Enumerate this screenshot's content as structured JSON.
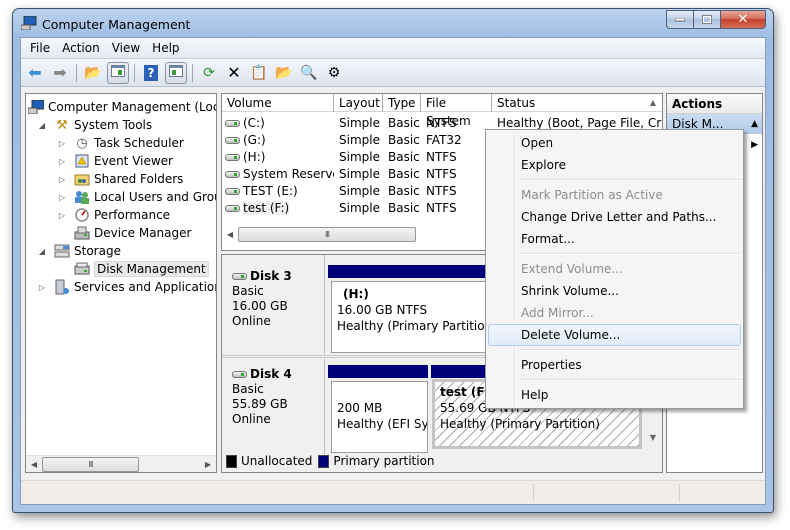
{
  "window": {
    "title": "Computer Management",
    "controls": {
      "minimize": "minimize",
      "maximize": "maximize",
      "close": "close"
    }
  },
  "menubar": [
    "File",
    "Action",
    "View",
    "Help"
  ],
  "toolbar": [
    {
      "name": "back-icon"
    },
    {
      "name": "forward-icon"
    },
    {
      "name": "up-folder-icon"
    },
    {
      "name": "show-hide-tree-icon"
    },
    {
      "name": "help-icon"
    },
    {
      "name": "show-hide-action-pane-icon"
    },
    {
      "name": "refresh-icon"
    },
    {
      "name": "delete-icon"
    },
    {
      "name": "properties-icon"
    },
    {
      "name": "open-folder-icon"
    },
    {
      "name": "search-icon"
    },
    {
      "name": "settings-icon"
    }
  ],
  "tree": {
    "items": [
      {
        "label": "Computer Management (Local",
        "level": 0,
        "expander": "",
        "icon": "computer-icon"
      },
      {
        "label": "System Tools",
        "level": 1,
        "expander": "◢",
        "icon": "tools-icon"
      },
      {
        "label": "Task Scheduler",
        "level": 2,
        "expander": "▷",
        "icon": "clock-icon"
      },
      {
        "label": "Event Viewer",
        "level": 2,
        "expander": "▷",
        "icon": "event-viewer-icon"
      },
      {
        "label": "Shared Folders",
        "level": 2,
        "expander": "▷",
        "icon": "shared-folder-icon"
      },
      {
        "label": "Local Users and Groups",
        "level": 2,
        "expander": "▷",
        "icon": "users-icon"
      },
      {
        "label": "Performance",
        "level": 2,
        "expander": "▷",
        "icon": "performance-icon"
      },
      {
        "label": "Device Manager",
        "level": 2,
        "expander": "",
        "icon": "device-manager-icon"
      },
      {
        "label": "Storage",
        "level": 1,
        "expander": "◢",
        "icon": "storage-icon"
      },
      {
        "label": "Disk Management",
        "level": 2,
        "expander": "",
        "icon": "disk-management-icon",
        "selected": true
      },
      {
        "label": "Services and Applications",
        "level": 1,
        "expander": "▷",
        "icon": "services-icon"
      }
    ],
    "scroll_thumb": "III"
  },
  "volumes": {
    "columns": [
      "Volume",
      "Layout",
      "Type",
      "File System",
      "Status"
    ],
    "rows": [
      {
        "volume": "(C:)",
        "layout": "Simple",
        "type": "Basic",
        "fs": "NTFS",
        "status": "Healthy (Boot, Page File, Cr"
      },
      {
        "volume": "(G:)",
        "layout": "Simple",
        "type": "Basic",
        "fs": "FAT32",
        "status": ""
      },
      {
        "volume": "(H:)",
        "layout": "Simple",
        "type": "Basic",
        "fs": "NTFS",
        "status": ""
      },
      {
        "volume": "System Reserved",
        "layout": "Simple",
        "type": "Basic",
        "fs": "NTFS",
        "status": ""
      },
      {
        "volume": "TEST (E:)",
        "layout": "Simple",
        "type": "Basic",
        "fs": "NTFS",
        "status": ""
      },
      {
        "volume": "test (F:)",
        "layout": "Simple",
        "type": "Basic",
        "fs": "NTFS",
        "status": ""
      }
    ],
    "scroll_thumb": "III"
  },
  "disks": [
    {
      "name": "Disk 3",
      "type": "Basic",
      "size": "16.00 GB",
      "state": "Online",
      "partitions": [
        {
          "label": "(H:)",
          "size": "16.00 GB NTFS",
          "status": "Healthy (Primary Partition)"
        }
      ]
    },
    {
      "name": "Disk 4",
      "type": "Basic",
      "size": "55.89 GB",
      "state": "Online",
      "partitions": [
        {
          "label": "",
          "size": "200 MB",
          "status": "Healthy (EFI Syst"
        },
        {
          "label": "test  (F:)",
          "size": "55.69 GB NTFS",
          "status": "Healthy (Primary Partition)"
        }
      ]
    }
  ],
  "legend": [
    {
      "label": "Unallocated",
      "color": "#000000"
    },
    {
      "label": "Primary partition",
      "color": "#00007b"
    }
  ],
  "actions": {
    "title": "Actions",
    "subheader": "Disk M..."
  },
  "context_menu": {
    "items": [
      {
        "label": "Open",
        "enabled": true
      },
      {
        "label": "Explore",
        "enabled": true
      },
      {
        "sep": true
      },
      {
        "label": "Mark Partition as Active",
        "enabled": false
      },
      {
        "label": "Change Drive Letter and Paths...",
        "enabled": true
      },
      {
        "label": "Format...",
        "enabled": true
      },
      {
        "sep": true
      },
      {
        "label": "Extend Volume...",
        "enabled": false
      },
      {
        "label": "Shrink Volume...",
        "enabled": true
      },
      {
        "label": "Add Mirror...",
        "enabled": false
      },
      {
        "label": "Delete Volume...",
        "enabled": true,
        "hover": true
      },
      {
        "sep": true
      },
      {
        "label": "Properties",
        "enabled": true
      },
      {
        "sep": true
      },
      {
        "label": "Help",
        "enabled": true
      }
    ]
  }
}
